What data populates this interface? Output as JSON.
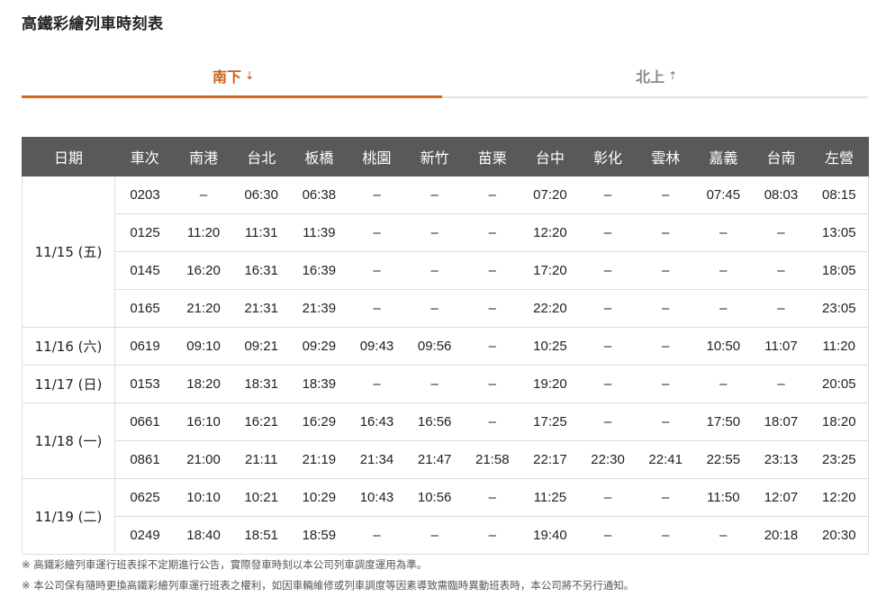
{
  "page": {
    "title": "高鐵彩繪列車時刻表"
  },
  "tabs": [
    {
      "label": "南下",
      "arrow": "⇣",
      "active": true
    },
    {
      "label": "北上",
      "arrow": "⇡",
      "active": false
    }
  ],
  "table": {
    "headers": [
      "日期",
      "車次",
      "南港",
      "台北",
      "板橋",
      "桃園",
      "新竹",
      "苗栗",
      "台中",
      "彰化",
      "雲林",
      "嘉義",
      "台南",
      "左營"
    ],
    "groups": [
      {
        "date": "11/15 (五)",
        "rows": [
          [
            "0203",
            "–",
            "06:30",
            "06:38",
            "–",
            "–",
            "–",
            "07:20",
            "–",
            "–",
            "07:45",
            "08:03",
            "08:15"
          ],
          [
            "0125",
            "11:20",
            "11:31",
            "11:39",
            "–",
            "–",
            "–",
            "12:20",
            "–",
            "–",
            "–",
            "–",
            "13:05"
          ],
          [
            "0145",
            "16:20",
            "16:31",
            "16:39",
            "–",
            "–",
            "–",
            "17:20",
            "–",
            "–",
            "–",
            "–",
            "18:05"
          ],
          [
            "0165",
            "21:20",
            "21:31",
            "21:39",
            "–",
            "–",
            "–",
            "22:20",
            "–",
            "–",
            "–",
            "–",
            "23:05"
          ]
        ]
      },
      {
        "date": "11/16 (六)",
        "rows": [
          [
            "0619",
            "09:10",
            "09:21",
            "09:29",
            "09:43",
            "09:56",
            "–",
            "10:25",
            "–",
            "–",
            "10:50",
            "11:07",
            "11:20"
          ]
        ]
      },
      {
        "date": "11/17 (日)",
        "rows": [
          [
            "0153",
            "18:20",
            "18:31",
            "18:39",
            "–",
            "–",
            "–",
            "19:20",
            "–",
            "–",
            "–",
            "–",
            "20:05"
          ]
        ]
      },
      {
        "date": "11/18 (一)",
        "rows": [
          [
            "0661",
            "16:10",
            "16:21",
            "16:29",
            "16:43",
            "16:56",
            "–",
            "17:25",
            "–",
            "–",
            "17:50",
            "18:07",
            "18:20"
          ],
          [
            "0861",
            "21:00",
            "21:11",
            "21:19",
            "21:34",
            "21:47",
            "21:58",
            "22:17",
            "22:30",
            "22:41",
            "22:55",
            "23:13",
            "23:25"
          ]
        ]
      },
      {
        "date": "11/19 (二)",
        "rows": [
          [
            "0625",
            "10:10",
            "10:21",
            "10:29",
            "10:43",
            "10:56",
            "–",
            "11:25",
            "–",
            "–",
            "11:50",
            "12:07",
            "12:20"
          ],
          [
            "0249",
            "18:40",
            "18:51",
            "18:59",
            "–",
            "–",
            "–",
            "19:40",
            "–",
            "–",
            "–",
            "20:18",
            "20:30"
          ]
        ]
      }
    ]
  },
  "notes": [
    "※ 高鐵彩繪列車運行班表採不定期進行公告，實際發車時刻以本公司列車調度運用為準。",
    "※ 本公司保有隨時更換高鐵彩繪列車運行班表之權利，如因車輛維修或列車調度等因素導致需臨時異動班表時，本公司將不另行通知。"
  ],
  "colors": {
    "accent": "#d2691e",
    "header_bg": "#595959"
  }
}
